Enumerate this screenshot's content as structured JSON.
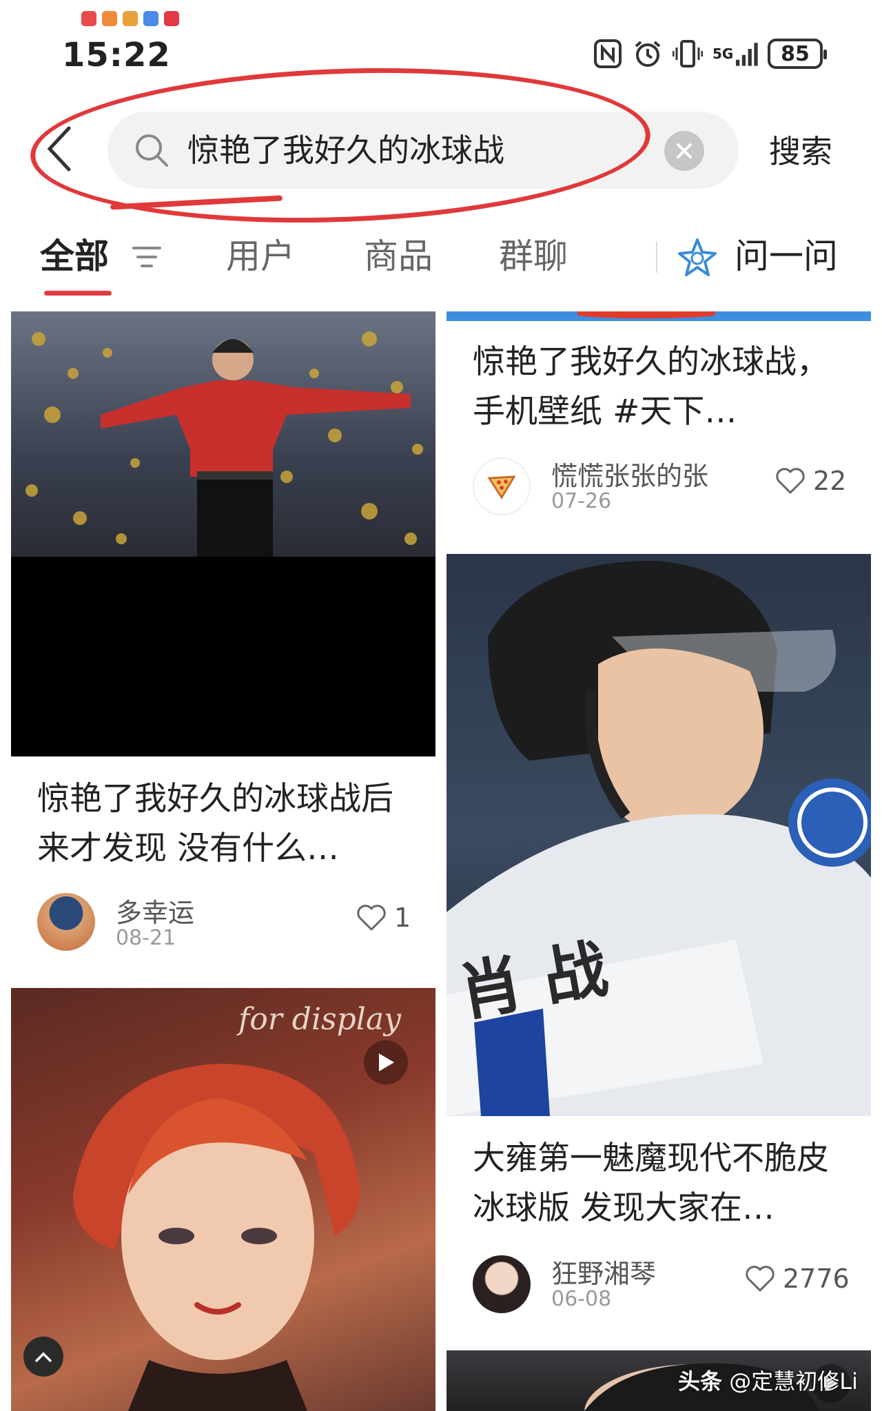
{
  "status_bar": {
    "time": "15:22",
    "network_label": "5G",
    "battery": "85",
    "notification_icon_colors": [
      "#e94a4a",
      "#f08a3a",
      "#e9a23a",
      "#4a8ae9",
      "#e23b45"
    ]
  },
  "search": {
    "query": "惊艳了我好久的冰球战",
    "submit_label": "搜索"
  },
  "tabs": [
    {
      "label": "全部",
      "active": true
    },
    {
      "label": "用户",
      "active": false
    },
    {
      "label": "商品",
      "active": false
    },
    {
      "label": "群聊",
      "active": false
    }
  ],
  "ask": {
    "label": "问一问",
    "icon": "star-assistant-icon"
  },
  "feed": {
    "left": [
      {
        "title": "惊艳了我好久的冰球战后来才发现 没有什么…",
        "author": "多幸运",
        "date": "08-21",
        "likes": "1"
      },
      {
        "video": true,
        "overlay_text": "for display"
      }
    ],
    "right": [
      {
        "title": "惊艳了我好久的冰球战，手机壁纸 #天下…",
        "author": "慌慌张张的张",
        "date": "07-26",
        "likes": "22"
      },
      {
        "jersey_text": "肖  战",
        "title": "大雍第一魅魔现代不脆皮冰球版 发现大家在…",
        "author": "狂野湘琴",
        "date": "06-08",
        "likes": "2776"
      }
    ]
  },
  "watermark": {
    "brand": "头条",
    "handle": "@定慧初修Li"
  },
  "colors": {
    "accent": "#e23b45",
    "annotation": "#e0393a"
  }
}
